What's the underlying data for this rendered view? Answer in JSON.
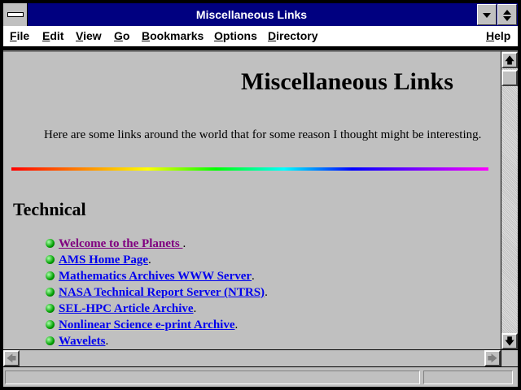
{
  "window": {
    "title": "Miscellaneous Links"
  },
  "menu": {
    "items": [
      {
        "u": "F",
        "rest": "ile"
      },
      {
        "u": "E",
        "rest": "dit"
      },
      {
        "u": "V",
        "rest": "iew"
      },
      {
        "u": "G",
        "rest": "o"
      },
      {
        "u": "B",
        "rest": "ookmarks"
      },
      {
        "u": "O",
        "rest": "ptions"
      },
      {
        "u": "D",
        "rest": "irectory"
      },
      {
        "u": "H",
        "rest": "elp"
      }
    ]
  },
  "page": {
    "heading": "Miscellaneous Links",
    "intro": "Here are some links around the world that for some reason I thought might be interesting.",
    "section": "Technical",
    "links": [
      {
        "text": "Welcome to the Planets ",
        "suffix": ".",
        "visited": true
      },
      {
        "text": "AMS Home Page",
        "suffix": ".",
        "visited": false
      },
      {
        "text": "Mathematics Archives WWW Server",
        "suffix": ".",
        "visited": false
      },
      {
        "text": "NASA Technical Report Server (NTRS)",
        "suffix": ".",
        "visited": false
      },
      {
        "text": "SEL-HPC Article Archive",
        "suffix": ".",
        "visited": false
      },
      {
        "text": "Nonlinear Science e-print Archive",
        "suffix": ".",
        "visited": false
      },
      {
        "text": "Wavelets",
        "suffix": ".",
        "visited": false
      }
    ],
    "colors": {
      "link": "#0000ee",
      "visited": "#800080",
      "background": "#c0c0c0"
    }
  },
  "scrollbar": {
    "up_icon": "arrow-up-icon",
    "down_icon": "arrow-down-icon",
    "left_icon": "arrow-left-icon",
    "right_icon": "arrow-right-icon"
  },
  "status": {
    "text": ""
  }
}
